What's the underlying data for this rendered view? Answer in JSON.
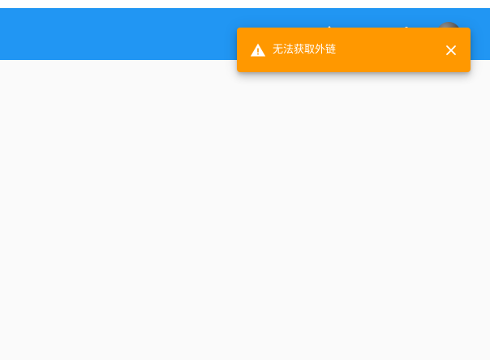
{
  "app_bar": {
    "background": "#2196f3",
    "icons": [
      "upload-icon",
      "more-vert-icon"
    ],
    "avatar": "user-avatar"
  },
  "snackbar": {
    "message": "无法获取外链",
    "background": "#ff9800",
    "icon": "warning-icon",
    "close_icon": "close-icon"
  }
}
